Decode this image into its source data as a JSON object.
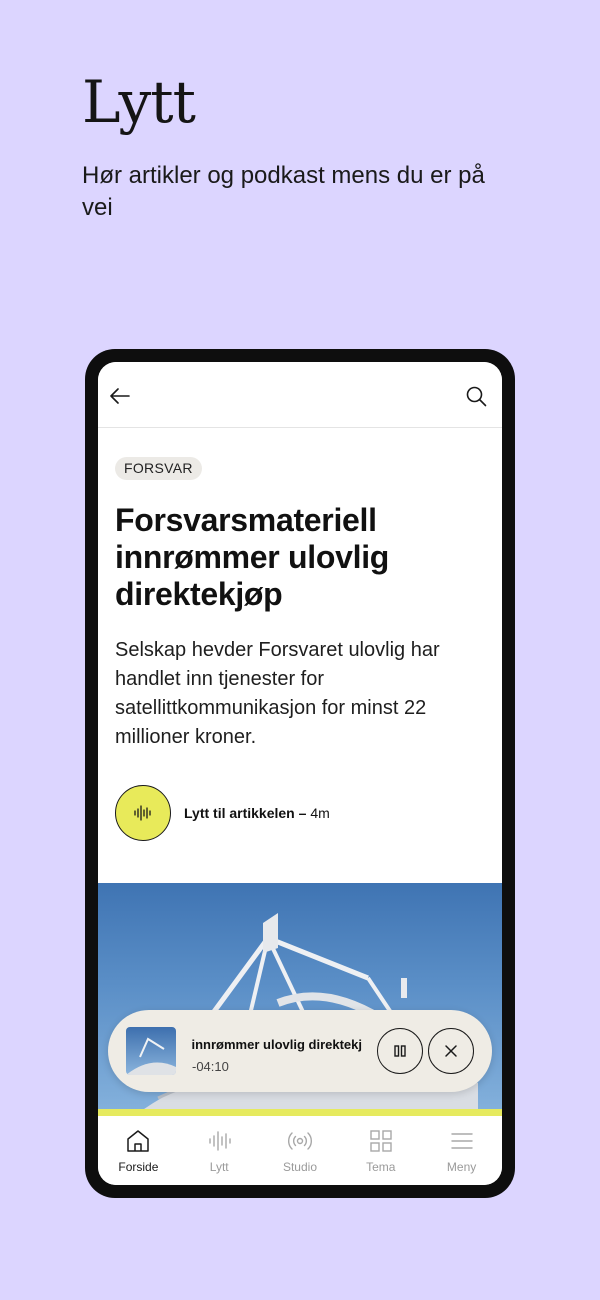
{
  "hero": {
    "title": "Lytt",
    "subtitle": "Hør artikler og podkast mens du er på vei"
  },
  "app": {
    "topbar": {
      "back_icon": "arrow-left-icon",
      "search_icon": "search-icon"
    },
    "article": {
      "tag": "FORSVAR",
      "headline": "Forsvarsmateriell innrømmer ulovlig direktekjøp",
      "lead": "Selskap hevder Forsvaret ulovlig har handlet inn tjenester for satellittkommunikasjon for minst 22 millioner kroner.",
      "listen": {
        "label": "Lytt til artikkelen –",
        "duration": "4m",
        "icon": "audio-wave-icon"
      }
    },
    "player": {
      "title": "ell innrømmer ulovlig direktekj",
      "time": "-04:10",
      "pause_icon": "pause-icon",
      "close_icon": "close-icon"
    },
    "tabs": [
      {
        "label": "Forside",
        "icon": "home-icon",
        "active": true
      },
      {
        "label": "Lytt",
        "icon": "audio-wave-icon",
        "active": false
      },
      {
        "label": "Studio",
        "icon": "broadcast-icon",
        "active": false
      },
      {
        "label": "Tema",
        "icon": "grid-icon",
        "active": false
      },
      {
        "label": "Meny",
        "icon": "menu-icon",
        "active": false
      }
    ],
    "colors": {
      "background": "#dcd5ff",
      "accent_yellow": "#e8ea5a",
      "player_bg": "#efece5"
    }
  }
}
